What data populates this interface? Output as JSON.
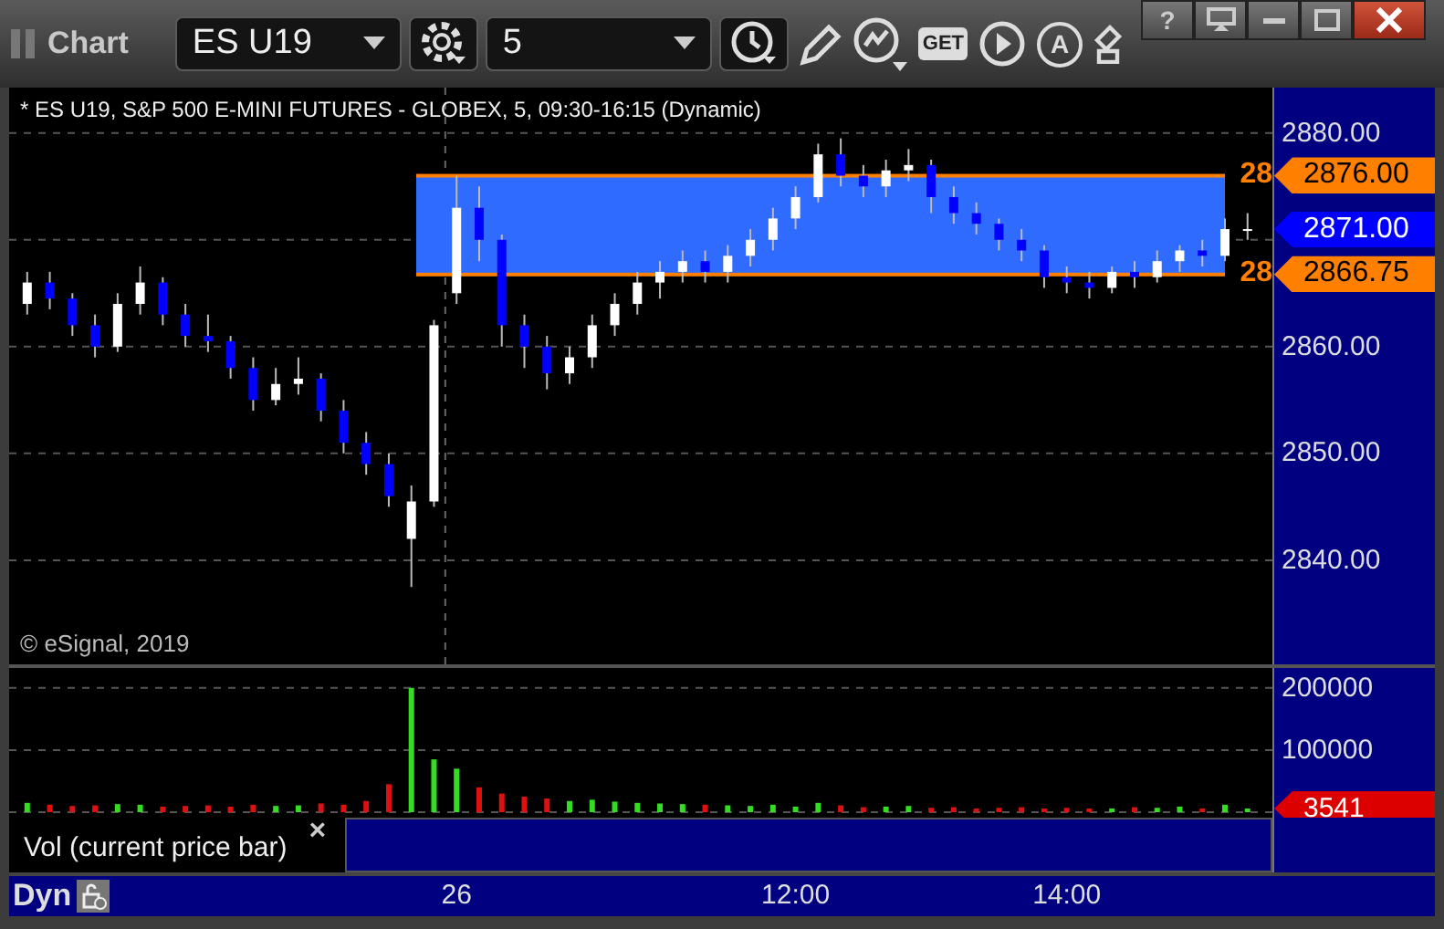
{
  "window": {
    "title": "Chart",
    "help_button": "?"
  },
  "toolbar": {
    "symbol": "ES U19",
    "interval": "5",
    "get_button": "GET",
    "auto_button": "A"
  },
  "price_pane": {
    "header": "* ES U19, S&P 500 E-MINI FUTURES - GLOBEX, 5, 09:30-16:15 (Dynamic)",
    "copyright": "© eSignal, 2019",
    "line_labels": [
      "28",
      "28"
    ],
    "chart_data": {
      "type": "candlestick",
      "ylim": [
        2830.25,
        2884.25
      ],
      "grid": true,
      "categories": [
        null,
        null,
        null,
        null,
        null,
        null,
        null,
        null,
        null,
        null,
        null,
        null,
        null,
        null,
        null,
        null,
        null,
        null,
        null,
        null,
        null,
        null,
        null,
        null,
        null,
        null,
        null,
        null,
        null,
        null,
        null,
        null,
        null,
        null,
        null,
        null,
        null,
        null,
        null,
        null,
        null,
        null,
        null,
        null,
        null,
        null,
        null,
        null,
        null,
        null,
        null,
        null,
        null,
        null,
        null
      ],
      "ohlc": [
        [
          2864,
          2867,
          2863,
          2866
        ],
        [
          2866,
          2867,
          2863.5,
          2864.5
        ],
        [
          2864.5,
          2865,
          2861,
          2862
        ],
        [
          2862,
          2863,
          2859,
          2860
        ],
        [
          2860,
          2865,
          2859.5,
          2864
        ],
        [
          2864,
          2867.5,
          2863,
          2866
        ],
        [
          2866,
          2866.5,
          2862,
          2863
        ],
        [
          2863,
          2864,
          2860,
          2861
        ],
        [
          2861,
          2863,
          2859.5,
          2860.5
        ],
        [
          2860.5,
          2861,
          2857,
          2858
        ],
        [
          2858,
          2859,
          2854,
          2855
        ],
        [
          2855,
          2858,
          2854.5,
          2856.5
        ],
        [
          2856.5,
          2859,
          2855.5,
          2857
        ],
        [
          2857,
          2857.5,
          2853,
          2854
        ],
        [
          2854,
          2855,
          2850,
          2851
        ],
        [
          2851,
          2852,
          2848,
          2849
        ],
        [
          2849,
          2850,
          2845,
          2846
        ],
        [
          2842,
          2847,
          2837.5,
          2845.5
        ],
        [
          2845.5,
          2862.5,
          2845,
          2862
        ],
        [
          2865,
          2876,
          2864,
          2873
        ],
        [
          2873,
          2875,
          2868,
          2870
        ],
        [
          2870,
          2870.5,
          2860,
          2862
        ],
        [
          2862,
          2863,
          2858,
          2860
        ],
        [
          2860,
          2861,
          2856,
          2857.5
        ],
        [
          2857.5,
          2860,
          2856.5,
          2859
        ],
        [
          2859,
          2863,
          2858,
          2862
        ],
        [
          2862,
          2865,
          2861,
          2864
        ],
        [
          2864,
          2867,
          2863,
          2866
        ],
        [
          2866,
          2868,
          2864.5,
          2867
        ],
        [
          2867,
          2869,
          2866,
          2868
        ],
        [
          2868,
          2869,
          2866,
          2867
        ],
        [
          2867,
          2869.5,
          2866,
          2868.5
        ],
        [
          2868.5,
          2871,
          2867.5,
          2870
        ],
        [
          2870,
          2873,
          2869,
          2872
        ],
        [
          2872,
          2875,
          2871,
          2874
        ],
        [
          2874,
          2879,
          2873.5,
          2878
        ],
        [
          2878,
          2879.5,
          2875,
          2876
        ],
        [
          2876,
          2877,
          2874,
          2875
        ],
        [
          2875,
          2877.5,
          2874,
          2876.5
        ],
        [
          2876.5,
          2878.5,
          2875.5,
          2877
        ],
        [
          2877,
          2877.5,
          2872.5,
          2874
        ],
        [
          2874,
          2875,
          2871.5,
          2872.5
        ],
        [
          2872.5,
          2873.5,
          2870.5,
          2871.5
        ],
        [
          2871.5,
          2872,
          2869,
          2870
        ],
        [
          2870,
          2871,
          2868,
          2869
        ],
        [
          2869,
          2869.5,
          2865.5,
          2866.5
        ],
        [
          2866.5,
          2867.5,
          2865,
          2866
        ],
        [
          2866,
          2867,
          2864.5,
          2865.5
        ],
        [
          2865.5,
          2867.5,
          2865,
          2867
        ],
        [
          2867,
          2868,
          2865.5,
          2866.5
        ],
        [
          2866.5,
          2869,
          2866,
          2868
        ],
        [
          2868,
          2869.5,
          2867,
          2869
        ],
        [
          2869,
          2870,
          2867.5,
          2868.5
        ],
        [
          2868.5,
          2872,
          2868,
          2871
        ],
        [
          2871,
          2872.5,
          2870,
          2871
        ]
      ],
      "yticks": [
        {
          "value": 2880,
          "label": "2880.00"
        },
        {
          "value": 2860,
          "label": "2860.00"
        },
        {
          "value": 2850,
          "label": "2850.00"
        },
        {
          "value": 2840,
          "label": "2840.00"
        }
      ]
    },
    "price_tags": [
      {
        "label": "2876.00",
        "color": "#ff8000"
      },
      {
        "label": "2871.00",
        "color": "#0000ff"
      },
      {
        "label": "2866.75",
        "color": "#ff8000"
      }
    ]
  },
  "volume_pane": {
    "chart_data": {
      "type": "bar",
      "ylim": [
        0,
        232000
      ],
      "grid": true,
      "categories": [
        null,
        null,
        null,
        null,
        null,
        null,
        null,
        null,
        null,
        null,
        null,
        null,
        null,
        null,
        null,
        null,
        null,
        null,
        null,
        "26",
        null,
        null,
        null,
        null,
        null,
        null,
        null,
        null,
        null,
        null,
        null,
        null,
        null,
        null,
        "12:00",
        null,
        null,
        null,
        null,
        null,
        null,
        null,
        null,
        null,
        null,
        null,
        "14:00",
        null,
        null,
        null,
        null,
        null,
        null,
        null,
        null
      ],
      "values": [
        15000,
        12000,
        10000,
        11000,
        13000,
        12000,
        9000,
        10000,
        11000,
        9000,
        12000,
        10000,
        11000,
        14000,
        12000,
        18000,
        45000,
        200000,
        85000,
        70000,
        40000,
        30000,
        25000,
        22000,
        18000,
        20000,
        17000,
        15000,
        14000,
        13000,
        12000,
        11000,
        10000,
        12000,
        9000,
        15000,
        11000,
        8000,
        9000,
        10000,
        7000,
        8000,
        6000,
        7000,
        8000,
        6000,
        7000,
        5000,
        6000,
        8000,
        7000,
        9000,
        6000,
        12000,
        4000
      ],
      "yticks": [
        {
          "value": 200000,
          "label": "200000"
        },
        {
          "value": 100000,
          "label": "100000"
        }
      ]
    },
    "tag": {
      "label": "3541",
      "color": "#dd0000"
    }
  },
  "legend": {
    "label": "Vol (current price bar)",
    "close": "×"
  },
  "time_axis": {
    "mode": "Dyn"
  }
}
